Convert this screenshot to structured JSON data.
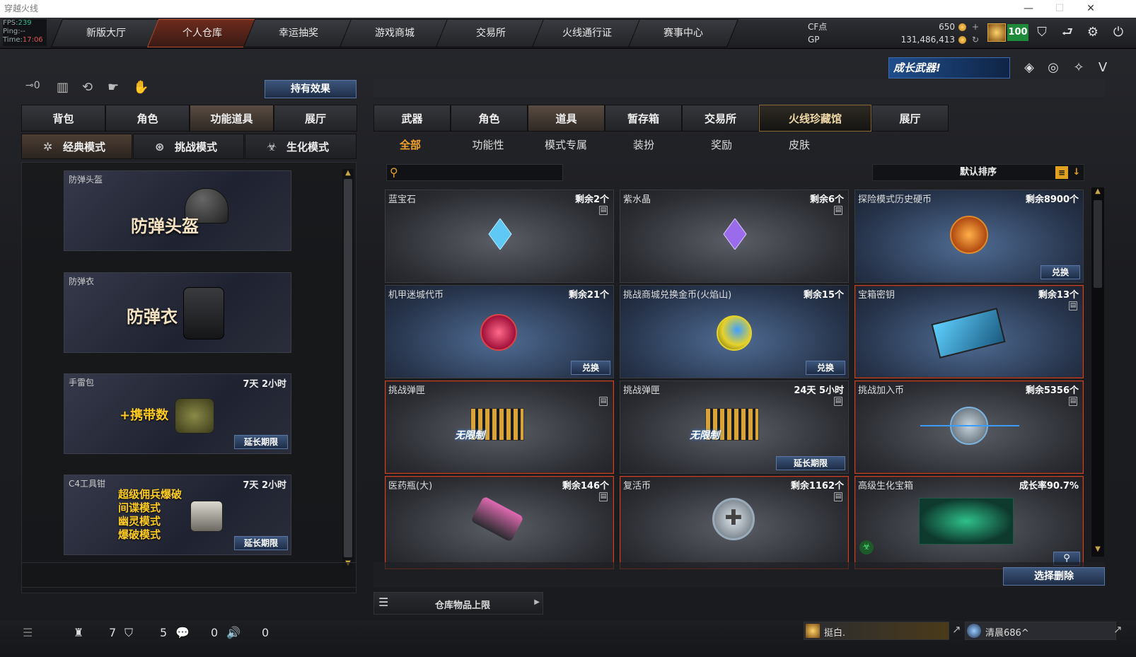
{
  "window": {
    "title": "穿越火线"
  },
  "fps_box": {
    "fps_label": "FPS:",
    "fps_value": "239",
    "ping_label": "Ping:",
    "ping_value": "--",
    "time_label": "Time:",
    "time_value": "17:06"
  },
  "nav": {
    "tabs": [
      {
        "label": "新版大厅",
        "active": false
      },
      {
        "label": "个人仓库",
        "active": true
      },
      {
        "label": "幸运抽奖",
        "active": false
      },
      {
        "label": "游戏商城",
        "active": false
      },
      {
        "label": "交易所",
        "active": false
      },
      {
        "label": "火线通行证",
        "active": false
      },
      {
        "label": "赛事中心",
        "active": false
      }
    ]
  },
  "currency": {
    "cf_label": "CF点",
    "cf_value": "650",
    "gp_label": "GP",
    "gp_value": "131,486,413",
    "level": "100"
  },
  "banner": {
    "text": "成长武器!"
  },
  "left": {
    "hold_effect": "持有效果",
    "tabs": [
      "背包",
      "角色",
      "功能道具",
      "展厅"
    ],
    "active_tab": 2,
    "modes": [
      "经典模式",
      "挑战模式",
      "生化模式"
    ],
    "cards": [
      {
        "name": "防弹头盔",
        "time": "",
        "big": "防弹头盔",
        "ext": ""
      },
      {
        "name": "防弹衣",
        "time": "",
        "big": "防弹衣",
        "ext": ""
      },
      {
        "name": "手雷包",
        "time": "7天 2小时",
        "big": "+携带数",
        "ext": "延长期限"
      },
      {
        "name": "C4工具钳",
        "time": "7天 2小时",
        "big": "",
        "ext": "延长期限",
        "lines": [
          "超级佣兵爆破",
          "间谍模式",
          "幽灵模式",
          "爆破模式"
        ]
      }
    ]
  },
  "right": {
    "tabs": [
      "武器",
      "角色",
      "道具",
      "暂存箱",
      "交易所",
      "火线珍藏馆",
      "展厅"
    ],
    "active_tab": 2,
    "subtabs": [
      "全部",
      "功能性",
      "模式专属",
      "装扮",
      "奖励",
      "皮肤"
    ],
    "active_subtab": 0,
    "search": {
      "placeholder": ""
    },
    "sort": "默认排序",
    "items": [
      {
        "name": "蓝宝石",
        "count": "剩余2个",
        "action": "",
        "style": "grey"
      },
      {
        "name": "紫水晶",
        "count": "剩余6个",
        "action": "",
        "style": "grey"
      },
      {
        "name": "探险模式历史硬币",
        "count": "剩余8900个",
        "action": "兑换",
        "style": "blue"
      },
      {
        "name": "机甲迷城代币",
        "count": "剩余21个",
        "action": "兑换",
        "style": "blue"
      },
      {
        "name": "挑战商城兑换金币(火焰山)",
        "count": "剩余15个",
        "action": "兑换",
        "style": "blue"
      },
      {
        "name": "宝箱密钥",
        "count": "剩余13个",
        "action": "",
        "style": "blue-red"
      },
      {
        "name": "挑战弹匣",
        "count": "",
        "action": "",
        "style": "red",
        "badge": "无限制"
      },
      {
        "name": "挑战弹匣",
        "count": "24天 5小时",
        "action": "延长期限",
        "style": "grey",
        "badge": "无限制"
      },
      {
        "name": "挑战加入币",
        "count": "剩余5356个",
        "action": "",
        "style": "red"
      },
      {
        "name": "医药瓶(大)",
        "count": "剩余146个",
        "action": "",
        "style": "red"
      },
      {
        "name": "复活币",
        "count": "剩余1162个",
        "action": "",
        "style": "red"
      },
      {
        "name": "高级生化宝箱",
        "count": "成长率90.7%",
        "action": "",
        "style": "red"
      }
    ],
    "select_delete": "选择删除",
    "capacity": "仓库物品上限"
  },
  "status": {
    "v1": "7",
    "v2": "5",
    "v3": "0",
    "v4": "0",
    "friend1": "挺白.",
    "friend2": "清晨686^"
  }
}
